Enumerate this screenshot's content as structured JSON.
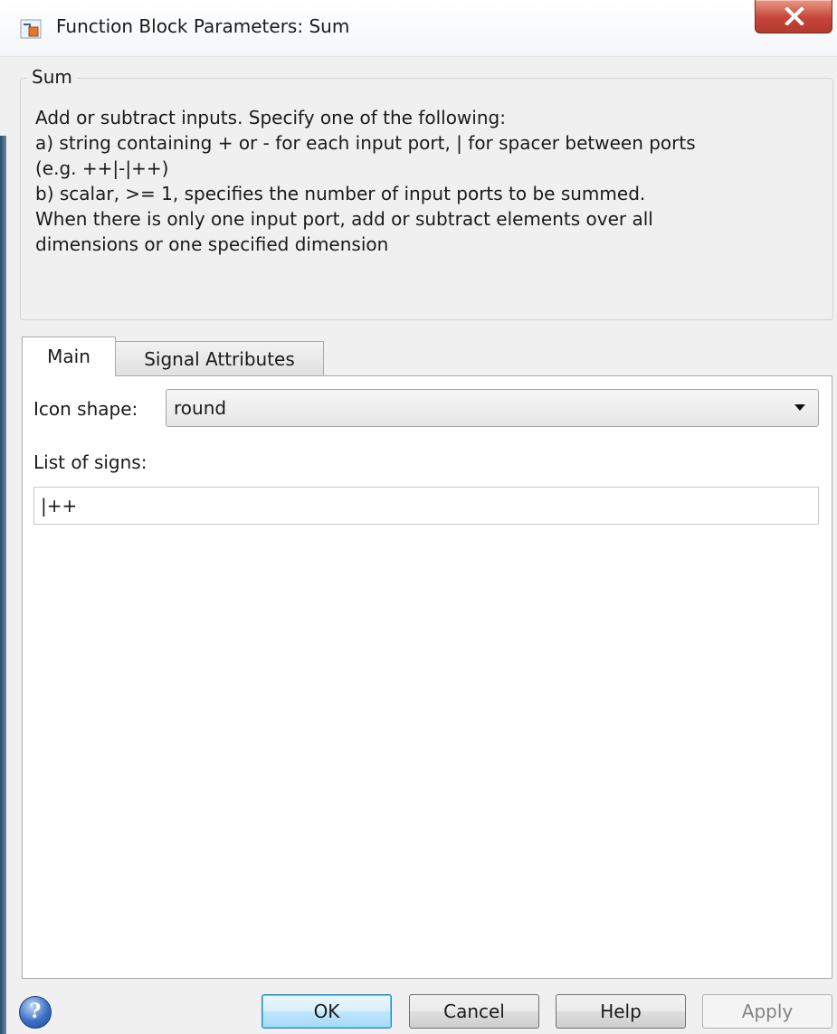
{
  "window": {
    "title": "Function Block Parameters: Sum",
    "close_icon": "close-x-icon",
    "app_icon": "simulink-block-icon"
  },
  "description": {
    "group_label": "Sum",
    "lines": [
      "Add or subtract inputs.  Specify one of the following:",
      "a) string containing + or - for each input port, | for spacer between ports",
      "(e.g. ++|-|++)",
      "b) scalar, >= 1, specifies the number of input ports to be summed.",
      "When there is only one input port, add or subtract elements over all",
      "dimensions or one specified dimension"
    ]
  },
  "tabs": [
    {
      "label": "Main",
      "selected": true
    },
    {
      "label": "Signal Attributes",
      "selected": false
    }
  ],
  "main": {
    "icon_shape": {
      "label": "Icon shape:",
      "value": "round"
    },
    "list_of_signs": {
      "label": "List of signs:",
      "value": "|++"
    }
  },
  "buttons": {
    "help_icon": "help-question-icon",
    "ok": "OK",
    "cancel": "Cancel",
    "help": "Help",
    "apply": "Apply"
  },
  "colors": {
    "close_button": "#c6453a",
    "ok_button_border": "#3c7fb1",
    "help_icon": "#3a6fc4",
    "disabled_text": "#838383"
  }
}
